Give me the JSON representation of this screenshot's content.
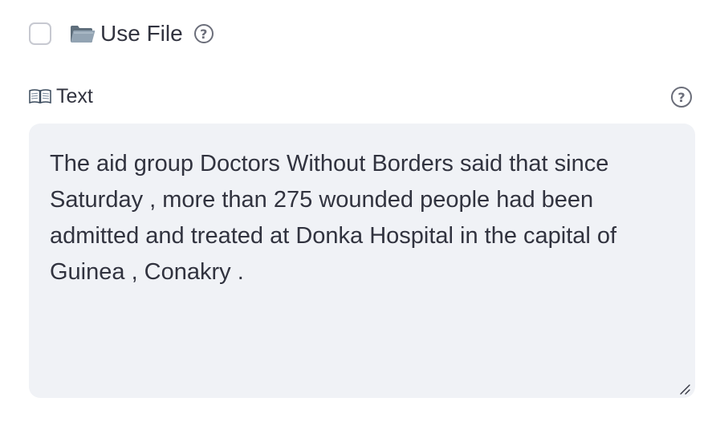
{
  "use_file": {
    "checked": false,
    "label": "Use File",
    "icon": "folder-icon",
    "help_icon": "question-circle-icon"
  },
  "text_input": {
    "label": "Text",
    "icon": "book-icon",
    "help_icon": "question-circle-icon",
    "value": "The aid group Doctors Without Borders said that since Saturday , more than 275 wounded people had been admitted and treated at Donka Hospital in the capital of Guinea , Conakry ."
  },
  "colors": {
    "text": "#31333f",
    "textarea_bg": "#f0f2f6",
    "checkbox_border": "#c7c9d1",
    "help_icon": "#6b6e7a"
  }
}
